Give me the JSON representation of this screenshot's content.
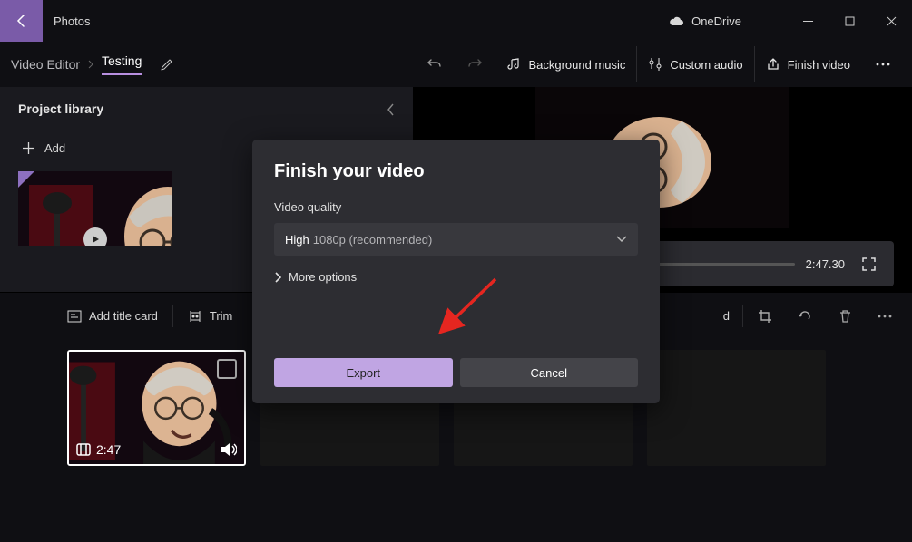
{
  "titlebar": {
    "app_name": "Photos",
    "onedrive_label": "OneDrive"
  },
  "breadcrumb": {
    "root": "Video Editor",
    "project": "Testing"
  },
  "toolbar": {
    "bg_music": "Background music",
    "custom_audio": "Custom audio",
    "finish_video": "Finish video"
  },
  "library": {
    "title": "Project library",
    "add_label": "Add"
  },
  "preview": {
    "timecode": "2:47.30"
  },
  "storyboard": {
    "add_title_card": "Add title card",
    "trim": "Trim",
    "speed_partial": "d",
    "clip_duration": "2:47"
  },
  "dialog": {
    "title": "Finish your video",
    "quality_label": "Video quality",
    "quality_high": "High",
    "quality_detail": "1080p (recommended)",
    "more_options": "More options",
    "export": "Export",
    "cancel": "Cancel"
  }
}
